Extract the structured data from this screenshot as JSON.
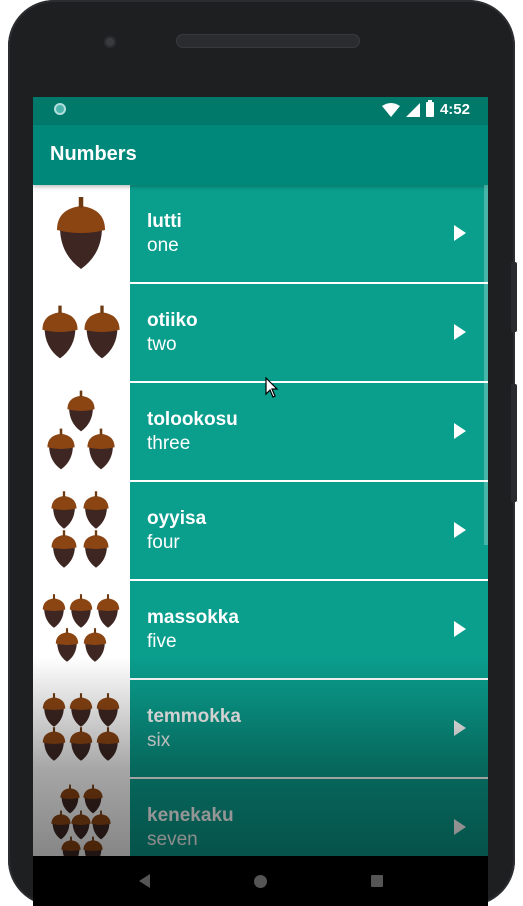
{
  "status_bar": {
    "time": "4:52"
  },
  "app_bar": {
    "title": "Numbers"
  },
  "items": [
    {
      "word": "lutti",
      "meaning": "one",
      "count": 1
    },
    {
      "word": "otiiko",
      "meaning": "two",
      "count": 2
    },
    {
      "word": "tolookosu",
      "meaning": "three",
      "count": 3
    },
    {
      "word": "oyyisa",
      "meaning": "four",
      "count": 4
    },
    {
      "word": "massokka",
      "meaning": "five",
      "count": 5
    },
    {
      "word": "temmokka",
      "meaning": "six",
      "count": 6
    },
    {
      "word": "kenekaku",
      "meaning": "seven",
      "count": 7
    }
  ],
  "icons": {
    "item_image": "acorn-icon",
    "play": "play-arrow-icon",
    "nav": [
      "back-icon",
      "home-icon",
      "recents-icon"
    ]
  },
  "colors": {
    "primary": "#009688",
    "primary_dark": "#00796b",
    "acorn_cap": "#8b4513",
    "acorn_body": "#3e2723"
  }
}
